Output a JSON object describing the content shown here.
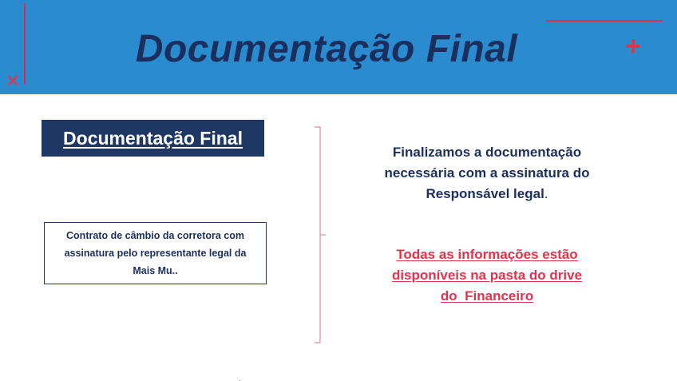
{
  "header": {
    "title": "Documentação Final",
    "background_color": "#2a8ccf",
    "accent_color": "#e0334f",
    "decorations": [
      "x-icon",
      "plus-icon"
    ]
  },
  "section_label": "Documentação Final",
  "contract_box": {
    "text": "Contrato de câmbio da corretora com assinatura pelo representante legal da Mais Mu.."
  },
  "main_text": {
    "line1": "Finalizamos a documentação",
    "line2": "necessária com a assinatura do",
    "line3": "Responsável legal",
    "period": "."
  },
  "drive_note": {
    "line1": "Todas as informações estão",
    "line2": "disponíveis na pasta do drive",
    "line3": "do  Financeiro"
  },
  "colors": {
    "navy": "#1f3764",
    "text_navy": "#1b2f5e",
    "red": "#e0334f"
  }
}
